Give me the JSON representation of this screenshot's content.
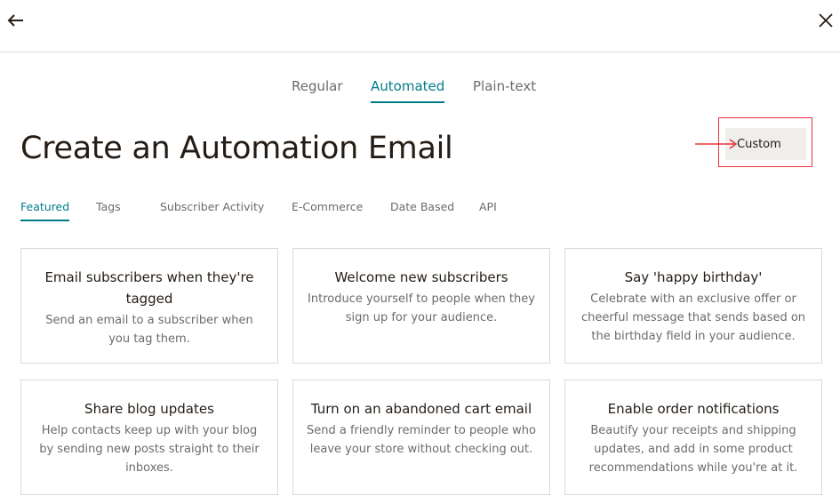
{
  "header": {
    "back_icon": "arrow-left-icon",
    "close_icon": "close-icon"
  },
  "type_tabs": [
    {
      "label": "Regular",
      "active": false
    },
    {
      "label": "Automated",
      "active": true
    },
    {
      "label": "Plain-text",
      "active": false
    }
  ],
  "page": {
    "title": "Create an Automation Email",
    "custom_label": "Custom"
  },
  "category_tabs": [
    {
      "label": "Featured",
      "active": true
    },
    {
      "label": "Tags",
      "active": false
    },
    {
      "label": "Subscriber Activity",
      "active": false
    },
    {
      "label": "E-Commerce",
      "active": false
    },
    {
      "label": "Date Based",
      "active": false
    },
    {
      "label": "API",
      "active": false
    }
  ],
  "cards": [
    {
      "title": "Email subscribers when they're tagged",
      "desc": "Send an email to a subscriber when you tag them."
    },
    {
      "title": "Welcome new subscribers",
      "desc": "Introduce yourself to people when they sign up for your audience."
    },
    {
      "title": "Say 'happy birthday'",
      "desc": "Celebrate with an exclusive offer or cheerful message that sends based on the birthday field in your audience."
    },
    {
      "title": "Share blog updates",
      "desc": "Help contacts keep up with your blog by sending new posts straight to their inboxes."
    },
    {
      "title": "Turn on an abandoned cart email",
      "desc": "Send a friendly reminder to people who leave your store without checking out."
    },
    {
      "title": "Enable order notifications",
      "desc": "Beautify your receipts and shipping updates, and add in some product recommendations while you're at it."
    }
  ],
  "colors": {
    "accent": "#007c89",
    "annotation_red": "#e8343a",
    "button_bg": "#efeeea",
    "text_dark": "#241c15",
    "text_muted": "#6b6b6b"
  }
}
